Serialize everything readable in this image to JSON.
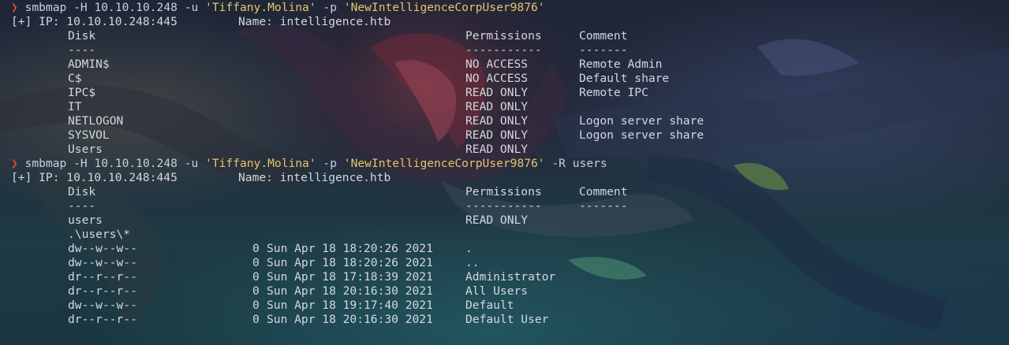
{
  "prompt_symbol": "❯",
  "session1": {
    "cmd_pre": "smbmap -H 10.10.10.248 -u ",
    "user": "'Tiffany.Molina'",
    "flag_p": " -p ",
    "password": "'NewIntelligenceCorpUser9876'",
    "ip_line": "[+] IP: 10.10.10.248:445",
    "name_line": "Name: intelligence.htb",
    "headers": {
      "disk": "Disk",
      "permissions": "Permissions",
      "comment": "Comment"
    },
    "dividers": {
      "disk": "----",
      "permissions": "-----------",
      "comment": "-------"
    },
    "shares": [
      {
        "name": "ADMIN$",
        "permissions": "NO ACCESS",
        "comment": "Remote Admin"
      },
      {
        "name": "C$",
        "permissions": "NO ACCESS",
        "comment": "Default share"
      },
      {
        "name": "IPC$",
        "permissions": "READ ONLY",
        "comment": "Remote IPC"
      },
      {
        "name": "IT",
        "permissions": "READ ONLY",
        "comment": ""
      },
      {
        "name": "NETLOGON",
        "permissions": "READ ONLY",
        "comment": "Logon server share"
      },
      {
        "name": "SYSVOL",
        "permissions": "READ ONLY",
        "comment": "Logon server share"
      },
      {
        "name": "Users",
        "permissions": "READ ONLY",
        "comment": ""
      }
    ]
  },
  "session2": {
    "cmd_pre": "smbmap -H 10.10.10.248 -u ",
    "user": "'Tiffany.Molina'",
    "flag_p": " -p ",
    "password": "'NewIntelligenceCorpUser9876'",
    "cmd_post": " -R users",
    "ip_line": "[+] IP: 10.10.10.248:445",
    "name_line": "Name: intelligence.htb",
    "headers": {
      "disk": "Disk",
      "permissions": "Permissions",
      "comment": "Comment"
    },
    "dividers": {
      "disk": "----",
      "permissions": "-----------",
      "comment": "-------"
    },
    "share": {
      "name": "users",
      "permissions": "READ ONLY"
    },
    "path": ".\\users\\*",
    "entries": [
      {
        "mode": "dw--w--w--",
        "size": "0",
        "date": "Sun Apr 18 18:20:26 2021",
        "name": "."
      },
      {
        "mode": "dw--w--w--",
        "size": "0",
        "date": "Sun Apr 18 18:20:26 2021",
        "name": ".."
      },
      {
        "mode": "dr--r--r--",
        "size": "0",
        "date": "Sun Apr 18 17:18:39 2021",
        "name": "Administrator"
      },
      {
        "mode": "dr--r--r--",
        "size": "0",
        "date": "Sun Apr 18 20:16:30 2021",
        "name": "All Users"
      },
      {
        "mode": "dw--w--w--",
        "size": "0",
        "date": "Sun Apr 18 19:17:40 2021",
        "name": "Default"
      },
      {
        "mode": "dr--r--r--",
        "size": "0",
        "date": "Sun Apr 18 20:16:30 2021",
        "name": "Default User"
      }
    ]
  },
  "colors": {
    "prompt_arrow": "#e0463a",
    "quoted_string": "#e7c46a",
    "text": "#d4d8dc"
  }
}
